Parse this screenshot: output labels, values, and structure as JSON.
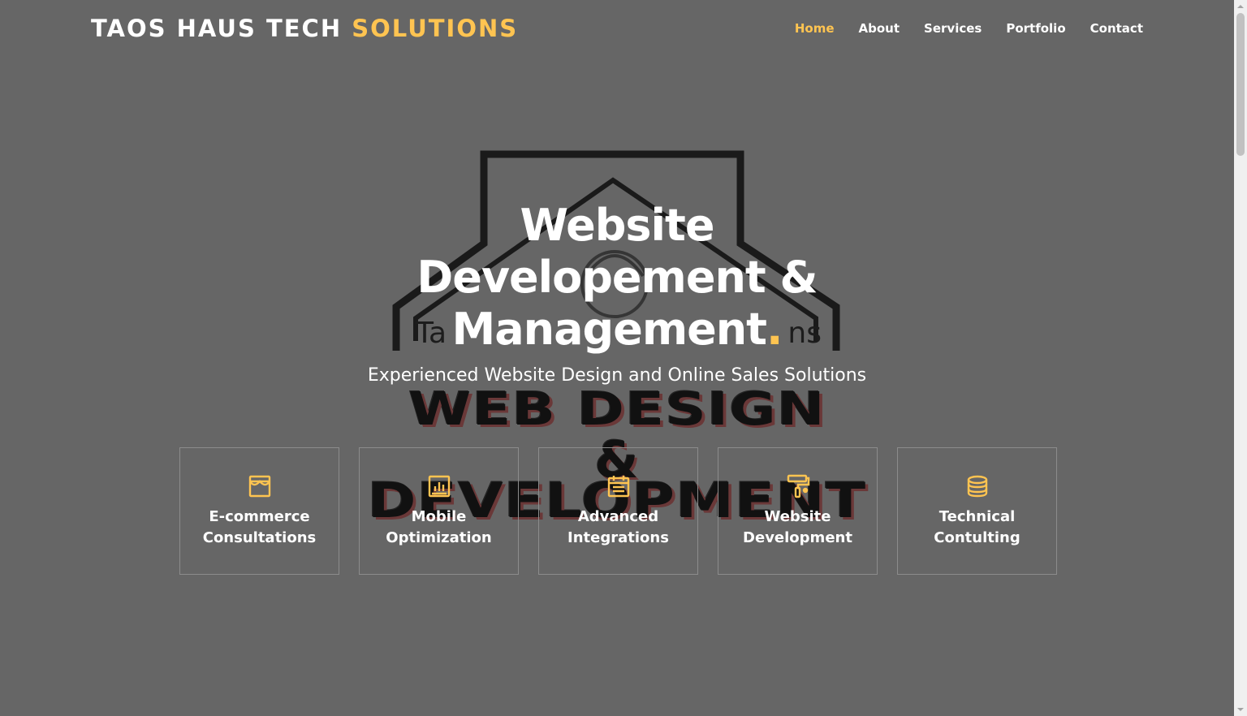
{
  "brand": {
    "part1": "TAOS HAUS TECH",
    "part2": "SOLUTIONS"
  },
  "nav": [
    {
      "label": "Home",
      "active": true
    },
    {
      "label": "About",
      "active": false
    },
    {
      "label": "Services",
      "active": false
    },
    {
      "label": "Portfolio",
      "active": false
    },
    {
      "label": "Contact",
      "active": false
    }
  ],
  "hero": {
    "title_line1": "Website",
    "title_line2": "Developement &",
    "title_line3": "Management",
    "title_dot": ".",
    "subtitle": "Experienced Website Design and Online Sales Solutions"
  },
  "background_logo": {
    "brand_left": "Ta",
    "brand_right": "ns",
    "line1": "WEB DESIGN",
    "line2": "&",
    "line3": "DEVELOPMENT"
  },
  "cards": [
    {
      "icon": "store-icon",
      "line1": "E-commerce",
      "line2": "Consultations"
    },
    {
      "icon": "bar-chart-icon",
      "line1": "Mobile",
      "line2": "Optimization"
    },
    {
      "icon": "calendar-icon",
      "line1": "Advanced",
      "line2": "Integrations"
    },
    {
      "icon": "paint-roller-icon",
      "line1": "Website",
      "line2": "Development"
    },
    {
      "icon": "database-icon",
      "line1": "Technical",
      "line2": "Contulting"
    }
  ],
  "colors": {
    "accent": "#ffc451",
    "background": "#666666",
    "text": "#ffffff"
  }
}
